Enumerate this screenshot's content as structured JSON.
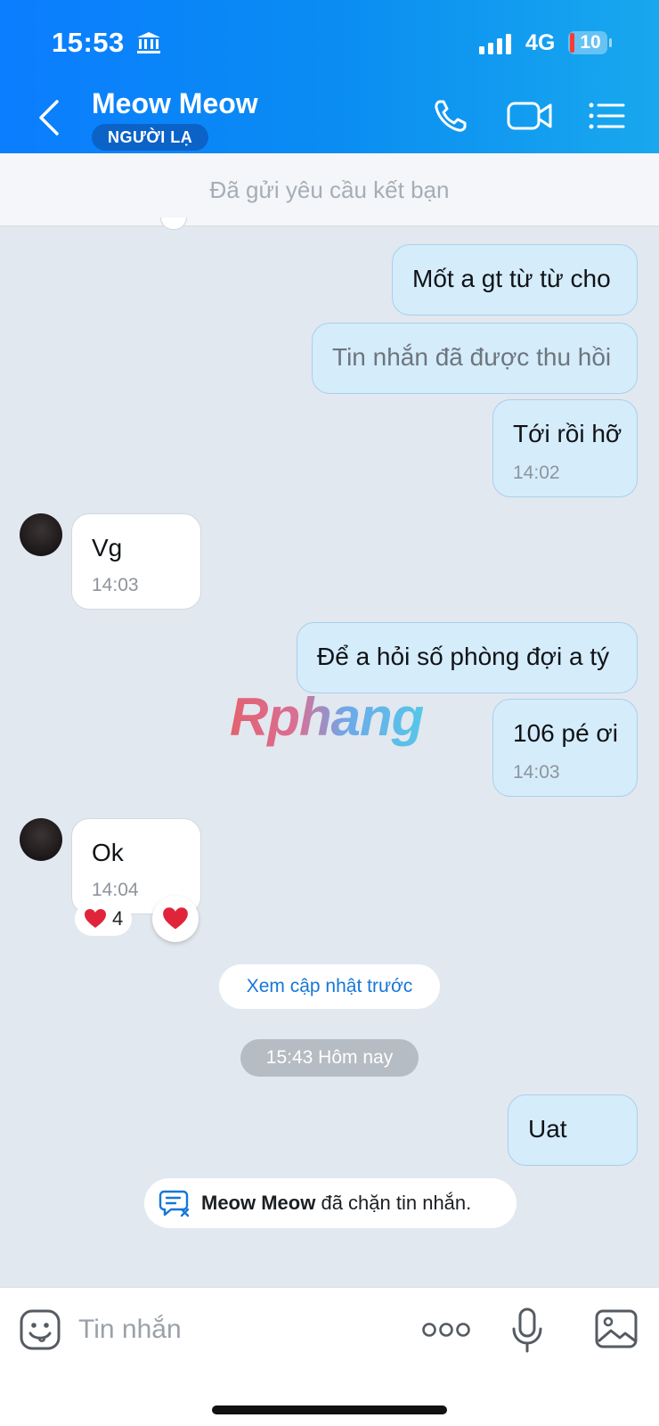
{
  "status_bar": {
    "time": "15:53",
    "network": "4G",
    "battery": "10"
  },
  "header": {
    "contact_name": "Meow Meow",
    "badge": "NGƯỜI LẠ"
  },
  "friend_request": "Đã gửi yêu cầu kết bạn",
  "messages": [
    {
      "side": "out",
      "text": "Mốt a gt từ từ cho",
      "time": ""
    },
    {
      "side": "out",
      "text": "Tin nhắn đã được thu hồi",
      "time": "",
      "recalled": true
    },
    {
      "side": "out",
      "text": "Tới rồi hỡ",
      "time": "14:02"
    },
    {
      "side": "in",
      "text": "Vg",
      "time": "14:03"
    },
    {
      "side": "out",
      "text": "Để a hỏi số phòng đợi a tý",
      "time": ""
    },
    {
      "side": "out",
      "text": "106 pé ơi",
      "time": "14:03"
    },
    {
      "side": "in",
      "text": "Ok",
      "time": "14:04",
      "reaction_count": "4"
    },
    {
      "side": "out",
      "text": "Uat",
      "time": ""
    }
  ],
  "view_older": "Xem cập nhật trước",
  "date_divider": "15:43 Hôm nay",
  "blocked_notice": {
    "name": "Meow Meow",
    "text": " đã chặn tin nhắn."
  },
  "watermark": "Rphang",
  "composer": {
    "placeholder": "Tin nhắn"
  },
  "colors": {
    "header_start": "#0b7dff",
    "header_end": "#18a8ee",
    "outgoing_bubble": "#d5ecfb",
    "link": "#1677d8",
    "reaction_heart": "#e0243a"
  }
}
